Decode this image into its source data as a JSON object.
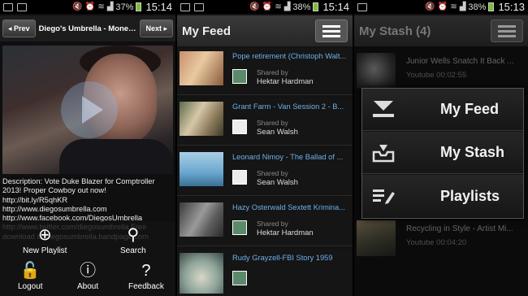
{
  "status_bars": [
    {
      "battery": "37%",
      "time": "15:14"
    },
    {
      "battery": "38%",
      "time": "15:14"
    },
    {
      "battery": "38%",
      "time": "15:13"
    }
  ],
  "player": {
    "prev_label": "Prev",
    "title": "Diego's Umbrella - Money...",
    "next_label": "Next",
    "description": "Description: Vote Duke Blazer for Comptroller 2013! Proper Cowboy out now! http://bit.ly/R5qhKR http://www.diegosumbrella.com http://www.facebook.com/DiegosUmbrella http://www.twitter.com/diegosumbrella Free download at diegosumbrella.bandpage.com"
  },
  "options_menu": {
    "new_playlist": "New Playlist",
    "search": "Search",
    "logout": "Logout",
    "about": "About",
    "feedback": "Feedback"
  },
  "feed": {
    "title": "My Feed",
    "shared_by_label": "Shared by",
    "items": [
      {
        "title": "Pope retirement (Christoph Walt...",
        "sharer": "Hektar Hardman"
      },
      {
        "title": "Grant Farm - Van Session 2 - B...",
        "sharer": "Sean Walsh"
      },
      {
        "title": "Leonard Nimoy - The Ballad of ...",
        "sharer": "Sean Walsh"
      },
      {
        "title": "Hazy Osterwald Sextett Krimina...",
        "sharer": "Hektar Hardman"
      },
      {
        "title": "Rudy Grayzell-FBI Story 1959",
        "sharer": ""
      }
    ]
  },
  "stash": {
    "title": "My Stash (4)",
    "items": [
      {
        "title": "Junior Wells Snatch It Back ...",
        "sub": "Youtube 00:02:55"
      },
      {
        "title": "Recycling in Style - Artist Mi...",
        "sub": "Youtube 00:04:20"
      }
    ]
  },
  "popup_menu": {
    "items": [
      {
        "label": "My Feed",
        "icon": "download-icon"
      },
      {
        "label": "My Stash",
        "icon": "inbox-icon"
      },
      {
        "label": "Playlists",
        "icon": "playlist-edit-icon"
      }
    ]
  }
}
